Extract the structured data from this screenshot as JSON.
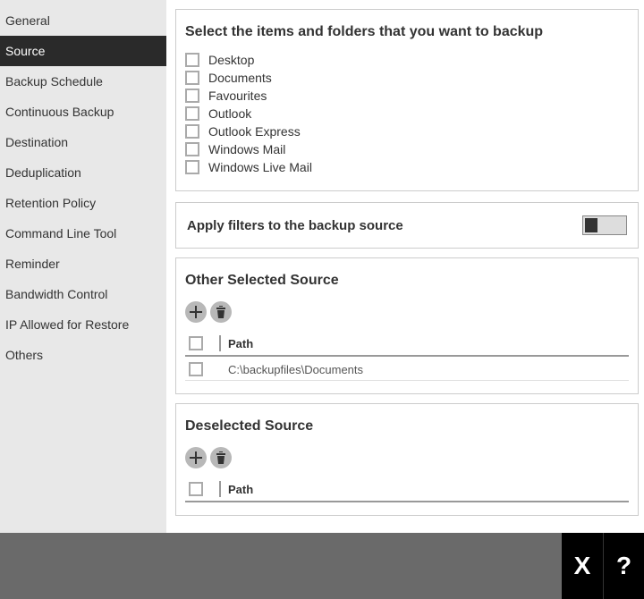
{
  "sidebar": {
    "items": [
      "General",
      "Source",
      "Backup Schedule",
      "Continuous Backup",
      "Destination",
      "Deduplication",
      "Retention Policy",
      "Command Line Tool",
      "Reminder",
      "Bandwidth Control",
      "IP Allowed for Restore",
      "Others"
    ],
    "active": "Source"
  },
  "select_panel": {
    "title": "Select the items and folders that you want to backup",
    "items": [
      "Desktop",
      "Documents",
      "Favourites",
      "Outlook",
      "Outlook Express",
      "Windows Mail",
      "Windows Live Mail"
    ]
  },
  "filter_panel": {
    "title": "Apply filters to the backup source",
    "enabled": false
  },
  "other_selected": {
    "title": "Other Selected Source",
    "header": "Path",
    "rows": [
      {
        "path": "C:\\backupfiles\\Documents"
      }
    ]
  },
  "deselected": {
    "title": "Deselected Source",
    "header": "Path",
    "rows": []
  },
  "footer": {
    "close": "X",
    "help": "?"
  }
}
